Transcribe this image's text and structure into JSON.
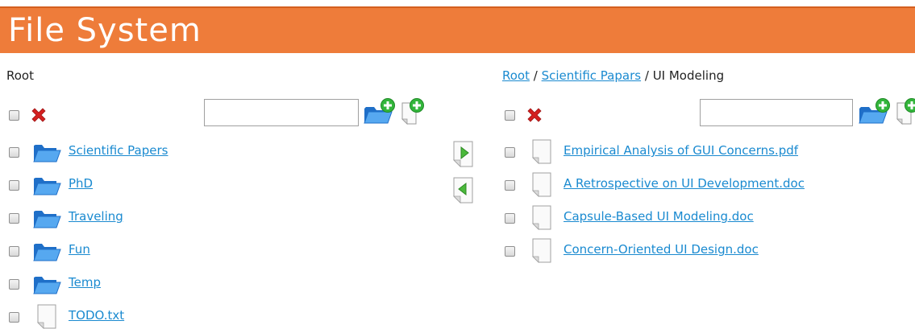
{
  "header": {
    "title": "File System"
  },
  "left_panel": {
    "breadcrumb": {
      "current": "Root"
    },
    "search": {
      "value": "",
      "placeholder": ""
    },
    "items": [
      {
        "type": "folder",
        "name": "Scientific Papers"
      },
      {
        "type": "folder",
        "name": "PhD"
      },
      {
        "type": "folder",
        "name": "Traveling"
      },
      {
        "type": "folder",
        "name": "Fun"
      },
      {
        "type": "folder",
        "name": "Temp"
      },
      {
        "type": "file",
        "name": "TODO.txt"
      }
    ]
  },
  "right_panel": {
    "breadcrumb": {
      "root": "Root",
      "parent": "Scientific Papars",
      "current": "UI Modeling",
      "separator": "/"
    },
    "search": {
      "value": "",
      "placeholder": ""
    },
    "items": [
      {
        "type": "file",
        "name": "Empirical Analysis of GUI Concerns.pdf"
      },
      {
        "type": "file",
        "name": "A Retrospective on UI Development.doc"
      },
      {
        "type": "file",
        "name": "Capsule-Based UI Modeling.doc"
      },
      {
        "type": "file",
        "name": "Concern-Oriented UI Design.doc"
      }
    ]
  },
  "transfer": {
    "move_right_icon": "move-right-icon",
    "move_left_icon": "move-left-icon"
  },
  "colors": {
    "header": "#ee7c3a",
    "link": "#1a8ad0",
    "folder": "#2f7fd8",
    "delete": "#d42020",
    "add": "#33b53b"
  }
}
